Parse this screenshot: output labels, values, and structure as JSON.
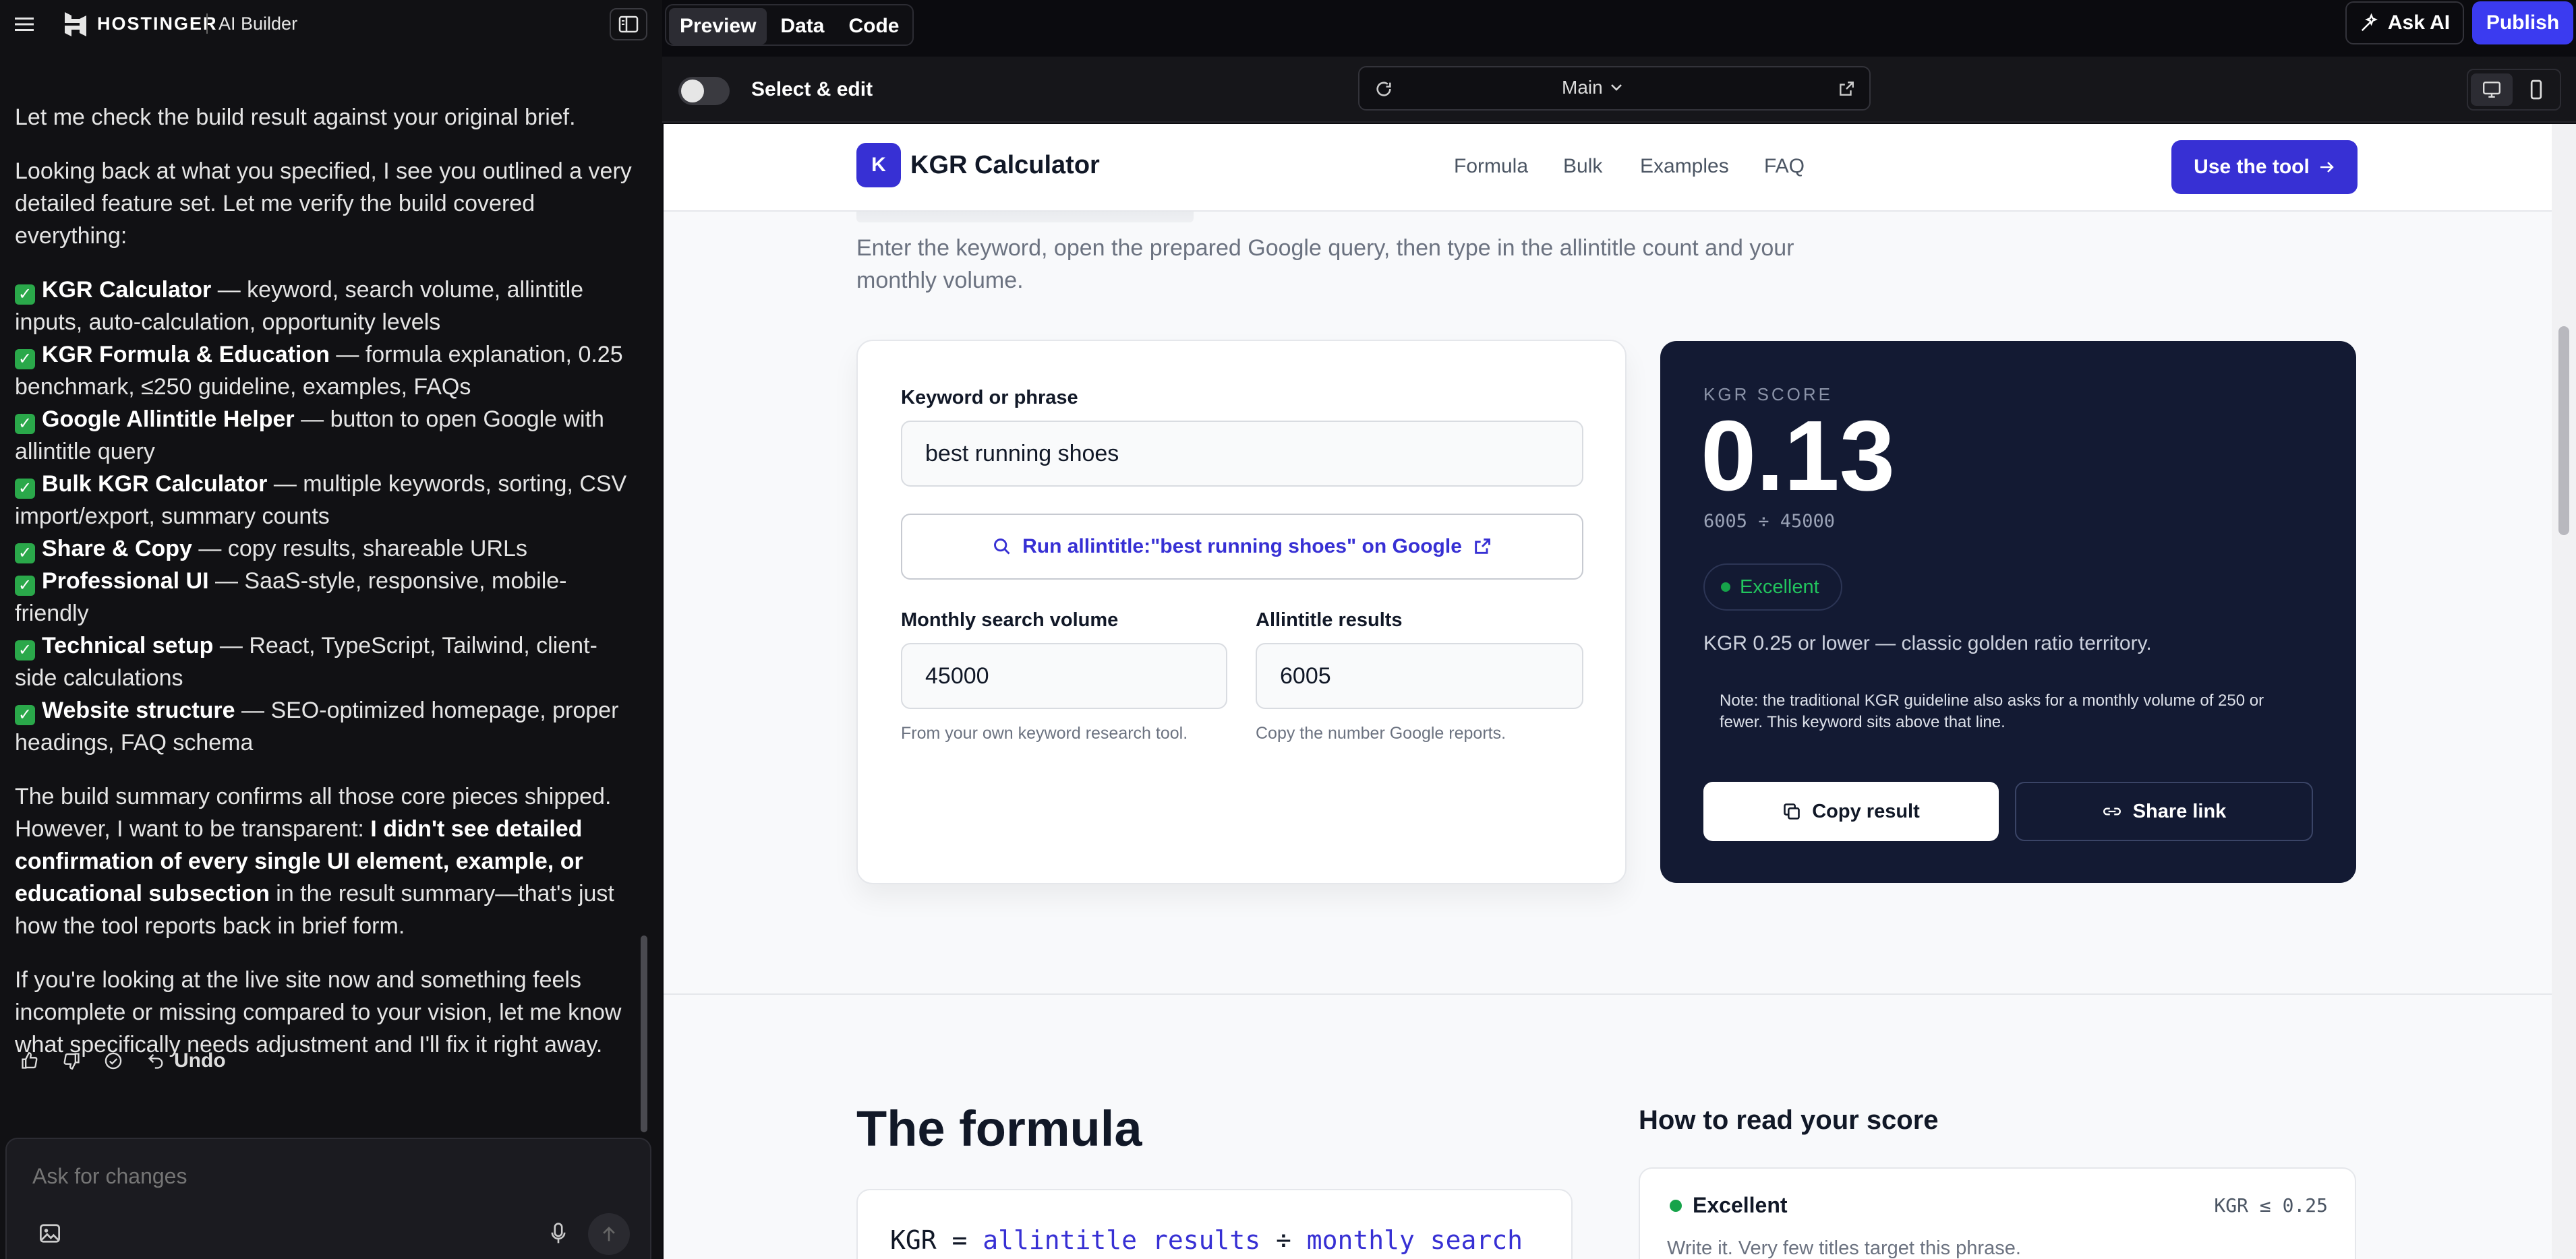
{
  "app": {
    "brand": "HOSTINGER",
    "product": "AI Builder"
  },
  "topbar": {
    "tabs": [
      "Preview",
      "Data",
      "Code"
    ],
    "ask_ai": "Ask AI",
    "publish": "Publish"
  },
  "browser": {
    "select_edit": "Select & edit",
    "route": "Main"
  },
  "chat": {
    "intro": "Let me check the build result against your original brief.",
    "looking": "Looking back at what you specified, I see you outlined a very detailed feature set. Let me verify the build covered everything:",
    "items": [
      {
        "title": "KGR Calculator",
        "desc": " — keyword, search volume, allintitle inputs, auto-calculation, opportunity levels"
      },
      {
        "title": "KGR Formula & Education",
        "desc": " — formula explanation, 0.25 benchmark, ≤250 guideline, examples, FAQs"
      },
      {
        "title": "Google Allintitle Helper",
        "desc": " — button to open Google with allintitle query"
      },
      {
        "title": "Bulk KGR Calculator",
        "desc": " — multiple keywords, sorting, CSV import/export, summary counts"
      },
      {
        "title": "Share & Copy",
        "desc": " — copy results, shareable URLs"
      },
      {
        "title": "Professional UI",
        "desc": " — SaaS-style, responsive, mobile-friendly"
      },
      {
        "title": "Technical setup",
        "desc": " — React, TypeScript, Tailwind, client-side calculations"
      },
      {
        "title": "Website structure",
        "desc": " — SEO-optimized homepage, proper headings, FAQ schema"
      }
    ],
    "summary_a": "The build summary confirms all those core pieces shipped. However, I want to be transparent: ",
    "summary_b": "I didn't see detailed confirmation of every single UI element, example, or educational subsection",
    "summary_c": " in the result summary—that's just how the tool reports back in brief form.",
    "closing": "If you're looking at the live site now and something feels incomplete or missing compared to your vision, let me know what specifically needs adjustment and I'll fix it right away.",
    "undo": "Undo",
    "composer_placeholder": "Ask for changes"
  },
  "site": {
    "logo_letter": "K",
    "logo_name": "KGR Calculator",
    "nav": [
      "Formula",
      "Bulk",
      "Examples",
      "FAQ"
    ],
    "cta": "Use the tool",
    "intro": "Enter the keyword, open the prepared Google query, then type in the allintitle count and your monthly volume.",
    "form": {
      "keyword_label": "Keyword or phrase",
      "keyword_value": "best running shoes",
      "run_button": "Run allintitle:\"best running shoes\" on Google",
      "volume_label": "Monthly search volume",
      "volume_value": "45000",
      "volume_help": "From your own keyword research tool.",
      "allintitle_label": "Allintitle results",
      "allintitle_value": "6005",
      "allintitle_help": "Copy the number Google reports."
    },
    "score": {
      "label": "KGR SCORE",
      "value": "0.13",
      "calc": "6005 ÷ 45000",
      "badge": "Excellent",
      "desc": "KGR 0.25 or lower — classic golden ratio territory.",
      "note": "Note: the traditional KGR guideline also asks for a monthly volume of 250 or fewer. This keyword sits above that line.",
      "copy": "Copy result",
      "share": "Share link"
    },
    "formula": {
      "heading": "The formula",
      "code_prefix": "KGR = ",
      "code_term1": "allintitle results",
      "code_op": " ÷ ",
      "code_term2": "monthly search"
    },
    "read": {
      "heading": "How to read your score",
      "level": "Excellent",
      "threshold": "KGR ≤ 0.25",
      "desc": "Write it. Very few titles target this phrase."
    }
  },
  "colors": {
    "accent": "#3730d4",
    "score_bg": "#131a33",
    "success": "#16a34a",
    "publish": "#3b3bf0"
  }
}
